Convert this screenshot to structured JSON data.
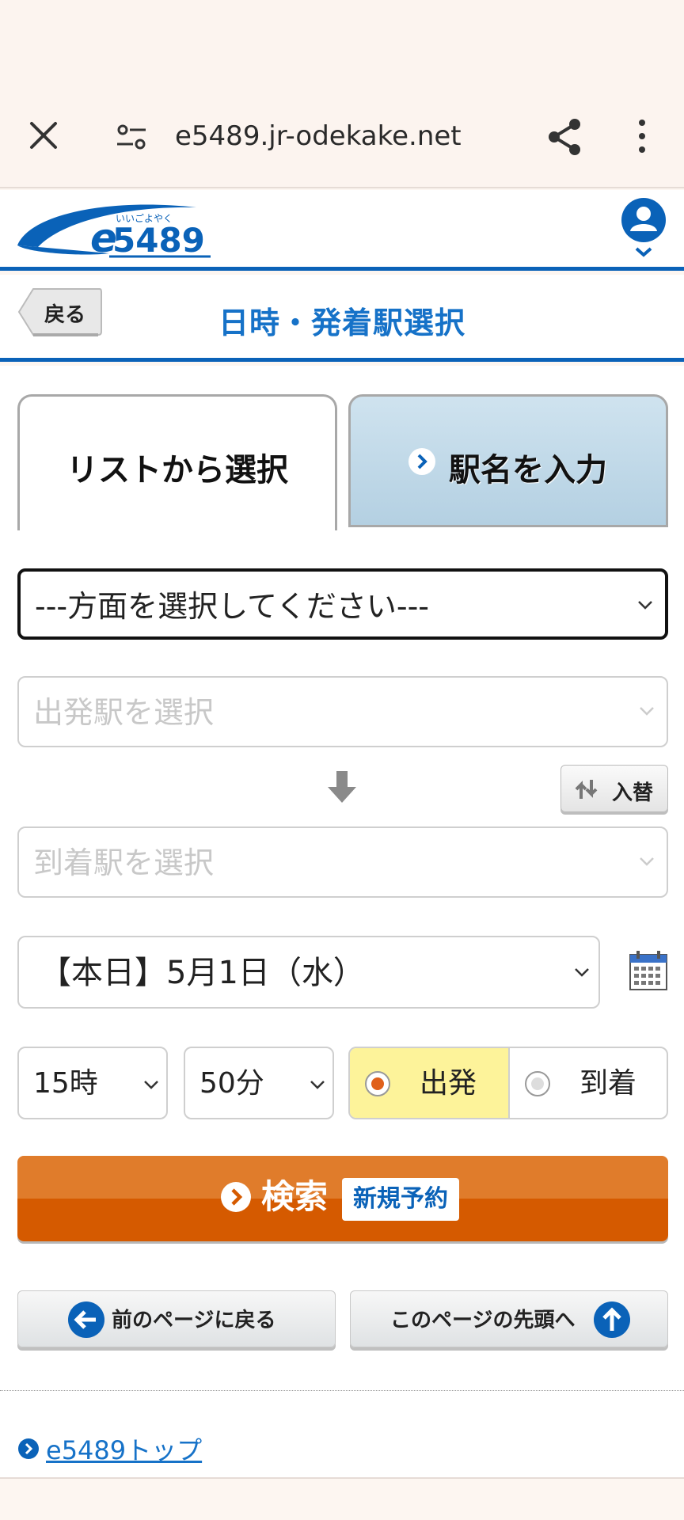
{
  "browser": {
    "url": "e5489.jr-odekake.net",
    "close_icon": "close-icon",
    "settings_icon": "page-settings-icon",
    "share_icon": "share-icon",
    "more_icon": "more-vert-icon"
  },
  "header": {
    "logo_text": "e5489",
    "logo_ruby": "いいごよやく",
    "user_icon": "user-account-icon"
  },
  "title_bar": {
    "back_label": "戻る",
    "title": "日時・発着駅選択"
  },
  "tabs": [
    {
      "label": "リストから選択",
      "active": true
    },
    {
      "label": "駅名を入力",
      "active": false
    }
  ],
  "form": {
    "direction": "---方面を選択してください---",
    "departure_placeholder": "出発駅を選択",
    "arrival_placeholder": "到着駅を選択",
    "swap_label": "入替",
    "date": "【本日】5月1日（水）",
    "hour": "15時",
    "minute": "50分",
    "radio_departure": "出発",
    "radio_arrival": "到着",
    "selected_radio": "出発"
  },
  "search": {
    "label": "検索",
    "badge": "新規予約"
  },
  "nav": {
    "back_page": "前のページに戻る",
    "page_top": "このページの先頭へ"
  },
  "footer": {
    "top_link": "e5489トップ"
  },
  "colors": {
    "brand_blue": "#0a62b8",
    "title_blue": "#1672c8",
    "search_orange": "#d55a00",
    "radio_highlight": "#fdf39a"
  }
}
